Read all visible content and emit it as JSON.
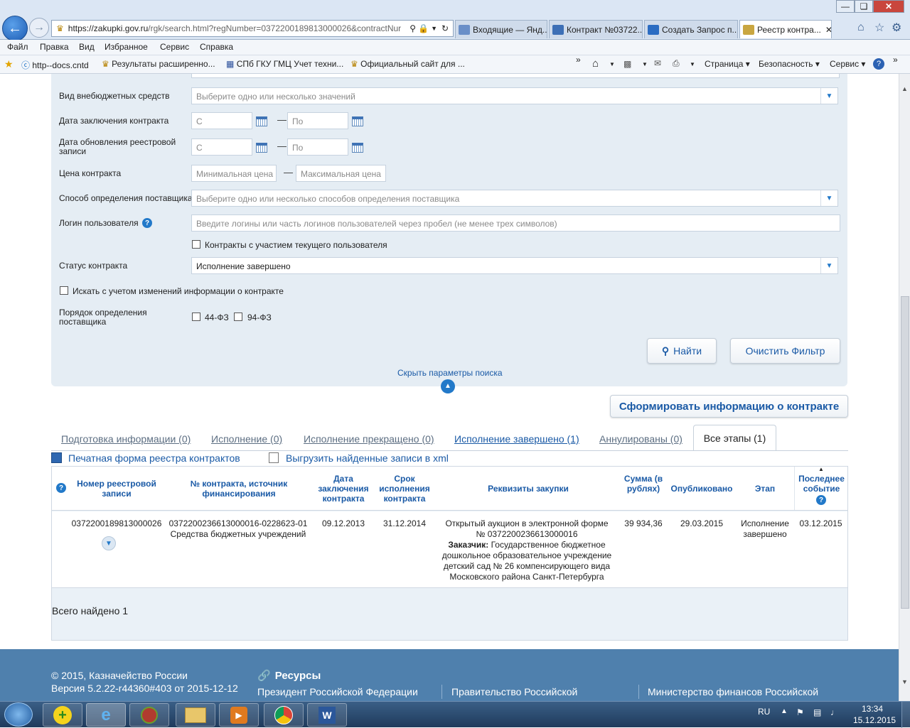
{
  "browser": {
    "url_main": "https://zakupki.gov.ru",
    "url_rest": "/rgk/search.html?regNumber=0372200189813000026&contractNur",
    "tabs": [
      {
        "label": "Входящие — Янд..."
      },
      {
        "label": "Контракт №03722..."
      },
      {
        "label": "Создать Запрос п..."
      },
      {
        "label": "Реестр контра..."
      }
    ],
    "menu": [
      "Файл",
      "Правка",
      "Вид",
      "Избранное",
      "Сервис",
      "Справка"
    ],
    "favorites": [
      "http--docs.cntd",
      "Результаты расширенно...",
      "СПб ГКУ ГМЦ Учет техни...",
      "Официальный сайт для ..."
    ],
    "commands": [
      "Страница",
      "Безопасность",
      "Сервис"
    ]
  },
  "filters": {
    "offbudget_label": "Вид внебюджетных средств",
    "offbudget_placeholder": "Выберите одно или несколько значений",
    "conclusion_label": "Дата заключения контракта",
    "update_label": "Дата обновления реестровой записи",
    "from_placeholder": "С",
    "to_placeholder": "По",
    "price_label": "Цена контракта",
    "price_min_placeholder": "Минимальная цена",
    "price_max_placeholder": "Максимальная цена",
    "method_label": "Способ определения поставщика",
    "method_placeholder": "Выберите одно или несколько способов определения поставщика",
    "login_label": "Логин пользователя",
    "login_placeholder": "Введите логины или часть логинов пользователей через пробел (не менее трех символов)",
    "current_user_label": "Контракты с участием текущего пользователя",
    "status_label": "Статус контракта",
    "status_value": "Исполнение завершено",
    "changes_label": "Искать с учетом изменений информации о контракте",
    "order_label": "Порядок определения поставщика",
    "law44": "44-ФЗ",
    "law94": "94-ФЗ",
    "find_button": "Найти",
    "clear_button": "Очистить Фильтр",
    "hide_link": "Скрыть параметры поиска"
  },
  "generate_button": "Сформировать информацию о контракте",
  "stage_tabs": [
    {
      "label": "Подготовка информации (0)"
    },
    {
      "label": "Исполнение (0)"
    },
    {
      "label": "Исполнение прекращено (0)"
    },
    {
      "label": "Исполнение завершено (1)"
    },
    {
      "label": "Аннулированы (0)"
    },
    {
      "label": "Все этапы (1)"
    }
  ],
  "print_link": "Печатная форма реестра контрактов",
  "export_link": "Выгрузить найденные записи в xml",
  "table": {
    "headers": {
      "reg_number": "Номер реестровой записи",
      "contract_number": "№ контракта, источник финансирования",
      "conclusion_date": "Дата заключения контракта",
      "term": "Срок исполнения контракта",
      "requisites": "Реквизиты закупки",
      "sum": "Сумма (в рублях)",
      "published": "Опубликовано",
      "stage": "Этап",
      "last_event": "Последнее событие"
    },
    "row": {
      "reg_number": "0372200189813000026",
      "contract_number": "0372200236613000016-0228623-01",
      "funding": "Средства бюджетных учреждений",
      "conclusion_date": "09.12.2013",
      "term": "31.12.2014",
      "auction": "Открытый аукцион в электронной форме",
      "auction_number": "№ 0372200236613000016",
      "customer_label": "Заказчик:",
      "customer_line1": "Государственное бюджетное",
      "customer_line2": "дошкольное образовательное учреждение",
      "customer_line3": "детский сад № 26 компенсирующего вида",
      "customer_line4": "Московского района Санкт-Петербурга",
      "sum": "39 934,36",
      "published": "29.03.2015",
      "stage_line1": "Исполнение",
      "stage_line2": "завершено",
      "last_event": "03.12.2015"
    },
    "total": "Всего найдено 1"
  },
  "footer": {
    "copyright": "© 2015, Казначейство России",
    "version": "Версия 5.2.22-r44360#403 от 2015-12-12",
    "resources_title": "Ресурсы",
    "links": [
      "Президент Российской Федерации",
      "Правительство Российской",
      "Министерство финансов Российской"
    ]
  },
  "taskbar": {
    "lang": "RU",
    "time": "13:34",
    "date": "15.12.2015"
  }
}
